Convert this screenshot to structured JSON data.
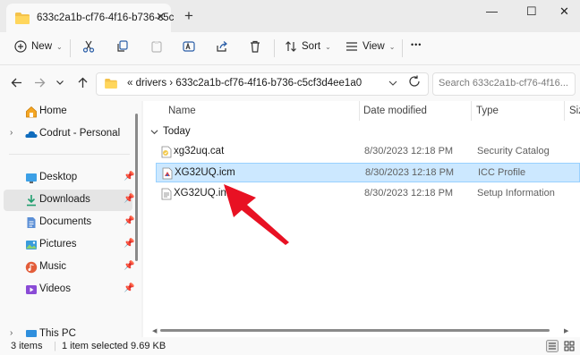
{
  "window": {
    "tab_title": "633c2a1b-cf76-4f16-b736-c5c",
    "close_tab": "✕",
    "new_tab": "+",
    "minimize": "—",
    "maximize": "☐",
    "close": "✕"
  },
  "toolbar": {
    "new_label": "New",
    "sort_label": "Sort",
    "view_label": "View",
    "more_label": "•••"
  },
  "address": {
    "path": "«  drivers  ›  633c2a1b-cf76-4f16-b736-c5cf3d4ee1a0",
    "search_placeholder": "Search 633c2a1b-cf76-4f16..."
  },
  "sidebar": {
    "items": [
      {
        "label": "Home",
        "icon": "home-icon"
      },
      {
        "label": "Codrut - Personal",
        "icon": "onedrive-icon"
      },
      {
        "label": "Desktop",
        "icon": "desktop-icon"
      },
      {
        "label": "Downloads",
        "icon": "downloads-icon"
      },
      {
        "label": "Documents",
        "icon": "documents-icon"
      },
      {
        "label": "Pictures",
        "icon": "pictures-icon"
      },
      {
        "label": "Music",
        "icon": "music-icon"
      },
      {
        "label": "Videos",
        "icon": "videos-icon"
      },
      {
        "label": "This PC",
        "icon": "pc-icon"
      }
    ]
  },
  "columns": {
    "name": "Name",
    "date": "Date modified",
    "type": "Type",
    "size": "Siz"
  },
  "group": {
    "label": "Today"
  },
  "files": [
    {
      "name": "xg32uq.cat",
      "date": "8/30/2023 12:18 PM",
      "type": "Security Catalog"
    },
    {
      "name": "XG32UQ.icm",
      "date": "8/30/2023 12:18 PM",
      "type": "ICC Profile"
    },
    {
      "name": "XG32UQ.inf",
      "date": "8/30/2023 12:18 PM",
      "type": "Setup Information"
    }
  ],
  "status": {
    "count": "3 items",
    "selected": "1 item selected  9.69 KB"
  },
  "colors": {
    "accent": "#0067c0",
    "selection": "#cce8ff",
    "annotation": "#e81123"
  }
}
